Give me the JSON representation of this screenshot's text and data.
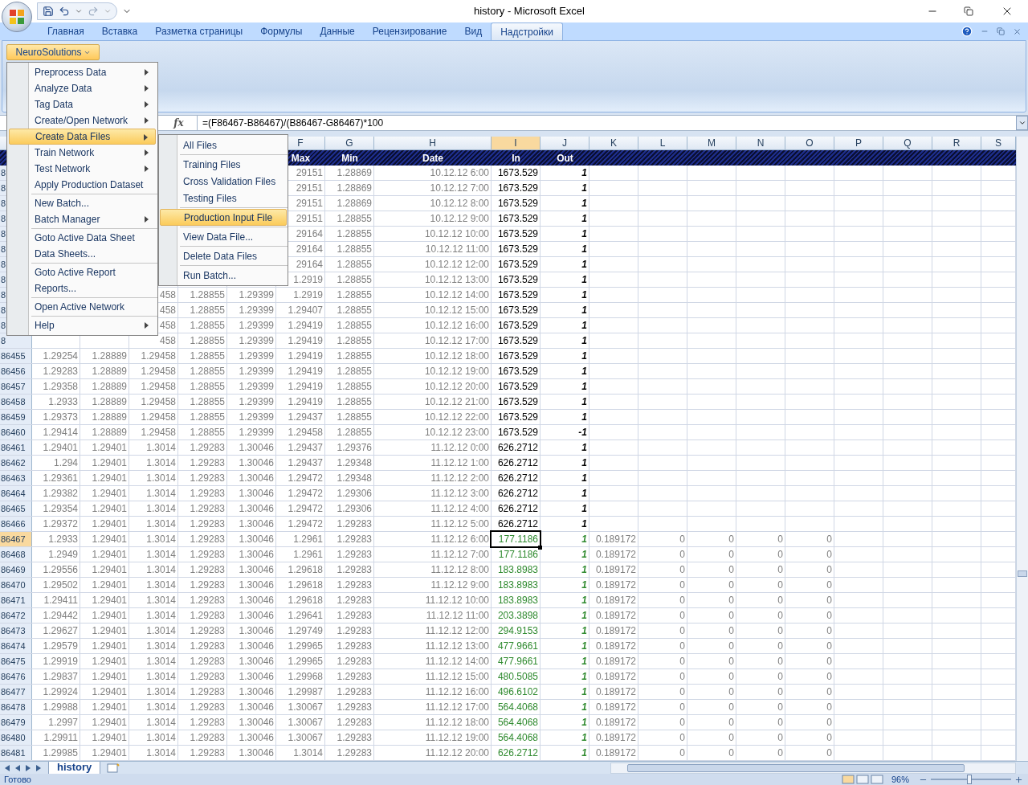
{
  "window": {
    "title": "history - Microsoft Excel"
  },
  "ribbon_tabs": [
    {
      "label": "Главная",
      "selected": false
    },
    {
      "label": "Вставка",
      "selected": false
    },
    {
      "label": "Разметка страницы",
      "selected": false
    },
    {
      "label": "Формулы",
      "selected": false
    },
    {
      "label": "Данные",
      "selected": false
    },
    {
      "label": "Рецензирование",
      "selected": false
    },
    {
      "label": "Вид",
      "selected": false
    },
    {
      "label": "Надстройки",
      "selected": true
    }
  ],
  "addin_button": {
    "label": "NeuroSolutions"
  },
  "formula_bar": {
    "function_label": "fx",
    "formula": "=(F86467-B86467)/(B86467-G86467)*100"
  },
  "main_menu": {
    "groups": [
      [
        {
          "label": "Preprocess Data",
          "submenu": true,
          "selected": false
        },
        {
          "label": "Analyze Data",
          "submenu": true,
          "selected": false
        },
        {
          "label": "Tag Data",
          "submenu": true,
          "selected": false
        },
        {
          "label": "Create/Open Network",
          "submenu": true,
          "selected": false
        },
        {
          "label": "Create Data Files",
          "submenu": true,
          "selected": true
        },
        {
          "label": "Train Network",
          "submenu": true,
          "selected": false
        },
        {
          "label": "Test Network",
          "submenu": true,
          "selected": false
        },
        {
          "label": "Apply Production Dataset",
          "submenu": false,
          "selected": false
        }
      ],
      [
        {
          "label": "New Batch...",
          "submenu": false,
          "selected": false
        },
        {
          "label": "Batch Manager",
          "submenu": true,
          "selected": false
        }
      ],
      [
        {
          "label": "Goto Active Data Sheet",
          "submenu": false,
          "selected": false
        },
        {
          "label": "Data Sheets...",
          "submenu": false,
          "selected": false
        }
      ],
      [
        {
          "label": "Goto Active Report",
          "submenu": false,
          "selected": false
        },
        {
          "label": "Reports...",
          "submenu": false,
          "selected": false
        }
      ],
      [
        {
          "label": "Open Active Network",
          "submenu": false,
          "selected": false
        }
      ],
      [
        {
          "label": "Help",
          "submenu": true,
          "selected": false
        }
      ]
    ]
  },
  "submenu": {
    "groups": [
      [
        {
          "label": "All Files",
          "selected": false
        }
      ],
      [
        {
          "label": "Training Files",
          "selected": false
        },
        {
          "label": "Cross Validation Files",
          "selected": false
        },
        {
          "label": "Testing Files",
          "selected": false
        }
      ],
      [
        {
          "label": "Production Input File",
          "selected": true
        }
      ],
      [
        {
          "label": "View Data File...",
          "selected": false
        }
      ],
      [
        {
          "label": "Delete Data Files",
          "selected": false
        }
      ],
      [
        {
          "label": "Run Batch...",
          "selected": false
        }
      ]
    ]
  },
  "columns": [
    {
      "letter": "F",
      "selected": false
    },
    {
      "letter": "G",
      "selected": false
    },
    {
      "letter": "H",
      "selected": false
    },
    {
      "letter": "I",
      "selected": true
    },
    {
      "letter": "J",
      "selected": false
    },
    {
      "letter": "K",
      "selected": false
    },
    {
      "letter": "L",
      "selected": false
    },
    {
      "letter": "M",
      "selected": false
    },
    {
      "letter": "N",
      "selected": false
    },
    {
      "letter": "O",
      "selected": false
    },
    {
      "letter": "P",
      "selected": false
    },
    {
      "letter": "Q",
      "selected": false
    },
    {
      "letter": "R",
      "selected": false
    },
    {
      "letter": "S",
      "selected": false
    }
  ],
  "title_row": {
    "F": "Max",
    "G": "Min",
    "H": "Date",
    "I": "In",
    "J": "Out"
  },
  "rows": [
    {
      "header": "8",
      "selected": false,
      "conditional_format": false,
      "cells": {
        "F": "29151",
        "G": "1.28869",
        "H": "10.12.12 6:00",
        "I": "1673.529",
        "J": "1"
      }
    },
    {
      "header": "8",
      "selected": false,
      "conditional_format": false,
      "cells": {
        "F": "29151",
        "G": "1.28869",
        "H": "10.12.12 7:00",
        "I": "1673.529",
        "J": "1"
      }
    },
    {
      "header": "8",
      "selected": false,
      "conditional_format": false,
      "cells": {
        "F": "29151",
        "G": "1.28869",
        "H": "10.12.12 8:00",
        "I": "1673.529",
        "J": "1"
      }
    },
    {
      "header": "8",
      "selected": false,
      "conditional_format": false,
      "cells": {
        "F": "29151",
        "G": "1.28855",
        "H": "10.12.12 9:00",
        "I": "1673.529",
        "J": "1"
      }
    },
    {
      "header": "8",
      "selected": false,
      "conditional_format": false,
      "cells": {
        "F": "29164",
        "G": "1.28855",
        "H": "10.12.12 10:00",
        "I": "1673.529",
        "J": "1"
      }
    },
    {
      "header": "8",
      "selected": false,
      "conditional_format": false,
      "cells": {
        "F": "29164",
        "G": "1.28855",
        "H": "10.12.12 11:00",
        "I": "1673.529",
        "J": "1"
      }
    },
    {
      "header": "8",
      "selected": false,
      "conditional_format": false,
      "cells": {
        "F": "29164",
        "G": "1.28855",
        "H": "10.12.12 12:00",
        "I": "1673.529",
        "J": "1"
      }
    },
    {
      "header": "8",
      "selected": false,
      "conditional_format": false,
      "cells": {
        "F": "1.2919",
        "G": "1.28855",
        "H": "10.12.12 13:00",
        "I": "1673.529",
        "J": "1"
      }
    },
    {
      "header": "8",
      "selected": false,
      "conditional_format": false,
      "cells": {
        "C": "458",
        "D": "1.28855",
        "E": "1.29399",
        "F": "1.2919",
        "G": "1.28855",
        "H": "10.12.12 14:00",
        "I": "1673.529",
        "J": "1"
      }
    },
    {
      "header": "8",
      "selected": false,
      "conditional_format": false,
      "cells": {
        "C": "458",
        "D": "1.28855",
        "E": "1.29399",
        "F": "1.29407",
        "G": "1.28855",
        "H": "10.12.12 15:00",
        "I": "1673.529",
        "J": "1"
      }
    },
    {
      "header": "8",
      "selected": false,
      "conditional_format": false,
      "cells": {
        "C": "458",
        "D": "1.28855",
        "E": "1.29399",
        "F": "1.29419",
        "G": "1.28855",
        "H": "10.12.12 16:00",
        "I": "1673.529",
        "J": "1"
      }
    },
    {
      "header": "8",
      "selected": false,
      "conditional_format": false,
      "cells": {
        "C": "458",
        "D": "1.28855",
        "E": "1.29399",
        "F": "1.29419",
        "G": "1.28855",
        "H": "10.12.12 17:00",
        "I": "1673.529",
        "J": "1"
      }
    },
    {
      "header": "86455",
      "selected": false,
      "conditional_format": false,
      "cells": {
        "A": "1.29254",
        "B": "1.28889",
        "C": "1.29458",
        "D": "1.28855",
        "E": "1.29399",
        "F": "1.29419",
        "G": "1.28855",
        "H": "10.12.12 18:00",
        "I": "1673.529",
        "J": "1"
      }
    },
    {
      "header": "86456",
      "selected": false,
      "conditional_format": false,
      "cells": {
        "A": "1.29283",
        "B": "1.28889",
        "C": "1.29458",
        "D": "1.28855",
        "E": "1.29399",
        "F": "1.29419",
        "G": "1.28855",
        "H": "10.12.12 19:00",
        "I": "1673.529",
        "J": "1"
      }
    },
    {
      "header": "86457",
      "selected": false,
      "conditional_format": false,
      "cells": {
        "A": "1.29358",
        "B": "1.28889",
        "C": "1.29458",
        "D": "1.28855",
        "E": "1.29399",
        "F": "1.29419",
        "G": "1.28855",
        "H": "10.12.12 20:00",
        "I": "1673.529",
        "J": "1"
      }
    },
    {
      "header": "86458",
      "selected": false,
      "conditional_format": false,
      "cells": {
        "A": "1.2933",
        "B": "1.28889",
        "C": "1.29458",
        "D": "1.28855",
        "E": "1.29399",
        "F": "1.29419",
        "G": "1.28855",
        "H": "10.12.12 21:00",
        "I": "1673.529",
        "J": "1"
      }
    },
    {
      "header": "86459",
      "selected": false,
      "conditional_format": false,
      "cells": {
        "A": "1.29373",
        "B": "1.28889",
        "C": "1.29458",
        "D": "1.28855",
        "E": "1.29399",
        "F": "1.29437",
        "G": "1.28855",
        "H": "10.12.12 22:00",
        "I": "1673.529",
        "J": "1"
      }
    },
    {
      "header": "86460",
      "selected": false,
      "conditional_format": false,
      "cells": {
        "A": "1.29414",
        "B": "1.28889",
        "C": "1.29458",
        "D": "1.28855",
        "E": "1.29399",
        "F": "1.29458",
        "G": "1.28855",
        "H": "10.12.12 23:00",
        "I": "1673.529",
        "J": "-1"
      }
    },
    {
      "header": "86461",
      "selected": false,
      "conditional_format": false,
      "cells": {
        "A": "1.29401",
        "B": "1.29401",
        "C": "1.3014",
        "D": "1.29283",
        "E": "1.30046",
        "F": "1.29437",
        "G": "1.29376",
        "H": "11.12.12 0:00",
        "I": "626.2712",
        "J": "1"
      }
    },
    {
      "header": "86462",
      "selected": false,
      "conditional_format": false,
      "cells": {
        "A": "1.294",
        "B": "1.29401",
        "C": "1.3014",
        "D": "1.29283",
        "E": "1.30046",
        "F": "1.29437",
        "G": "1.29348",
        "H": "11.12.12 1:00",
        "I": "626.2712",
        "J": "1"
      }
    },
    {
      "header": "86463",
      "selected": false,
      "conditional_format": false,
      "cells": {
        "A": "1.29361",
        "B": "1.29401",
        "C": "1.3014",
        "D": "1.29283",
        "E": "1.30046",
        "F": "1.29472",
        "G": "1.29348",
        "H": "11.12.12 2:00",
        "I": "626.2712",
        "J": "1"
      }
    },
    {
      "header": "86464",
      "selected": false,
      "conditional_format": false,
      "cells": {
        "A": "1.29382",
        "B": "1.29401",
        "C": "1.3014",
        "D": "1.29283",
        "E": "1.30046",
        "F": "1.29472",
        "G": "1.29306",
        "H": "11.12.12 3:00",
        "I": "626.2712",
        "J": "1"
      }
    },
    {
      "header": "86465",
      "selected": false,
      "conditional_format": false,
      "cells": {
        "A": "1.29354",
        "B": "1.29401",
        "C": "1.3014",
        "D": "1.29283",
        "E": "1.30046",
        "F": "1.29472",
        "G": "1.29306",
        "H": "11.12.12 4:00",
        "I": "626.2712",
        "J": "1"
      }
    },
    {
      "header": "86466",
      "selected": false,
      "conditional_format": false,
      "cells": {
        "A": "1.29372",
        "B": "1.29401",
        "C": "1.3014",
        "D": "1.29283",
        "E": "1.30046",
        "F": "1.29472",
        "G": "1.29283",
        "H": "11.12.12 5:00",
        "I": "626.2712",
        "J": "1"
      }
    },
    {
      "header": "86467",
      "selected": true,
      "conditional_format": true,
      "cells": {
        "A": "1.2933",
        "B": "1.29401",
        "C": "1.3014",
        "D": "1.29283",
        "E": "1.30046",
        "F": "1.2961",
        "G": "1.29283",
        "H": "11.12.12 6:00",
        "I": "177.1186",
        "J": "1",
        "K": "0.189172",
        "L": "0",
        "M": "0",
        "N": "0",
        "O": "0"
      }
    },
    {
      "header": "86468",
      "selected": false,
      "conditional_format": true,
      "cells": {
        "A": "1.2949",
        "B": "1.29401",
        "C": "1.3014",
        "D": "1.29283",
        "E": "1.30046",
        "F": "1.2961",
        "G": "1.29283",
        "H": "11.12.12 7:00",
        "I": "177.1186",
        "J": "1",
        "K": "0.189172",
        "L": "0",
        "M": "0",
        "N": "0",
        "O": "0"
      }
    },
    {
      "header": "86469",
      "selected": false,
      "conditional_format": true,
      "cells": {
        "A": "1.29556",
        "B": "1.29401",
        "C": "1.3014",
        "D": "1.29283",
        "E": "1.30046",
        "F": "1.29618",
        "G": "1.29283",
        "H": "11.12.12 8:00",
        "I": "183.8983",
        "J": "1",
        "K": "0.189172",
        "L": "0",
        "M": "0",
        "N": "0",
        "O": "0"
      }
    },
    {
      "header": "86470",
      "selected": false,
      "conditional_format": true,
      "cells": {
        "A": "1.29502",
        "B": "1.29401",
        "C": "1.3014",
        "D": "1.29283",
        "E": "1.30046",
        "F": "1.29618",
        "G": "1.29283",
        "H": "11.12.12 9:00",
        "I": "183.8983",
        "J": "1",
        "K": "0.189172",
        "L": "0",
        "M": "0",
        "N": "0",
        "O": "0"
      }
    },
    {
      "header": "86471",
      "selected": false,
      "conditional_format": true,
      "cells": {
        "A": "1.29411",
        "B": "1.29401",
        "C": "1.3014",
        "D": "1.29283",
        "E": "1.30046",
        "F": "1.29618",
        "G": "1.29283",
        "H": "11.12.12 10:00",
        "I": "183.8983",
        "J": "1",
        "K": "0.189172",
        "L": "0",
        "M": "0",
        "N": "0",
        "O": "0"
      }
    },
    {
      "header": "86472",
      "selected": false,
      "conditional_format": true,
      "cells": {
        "A": "1.29442",
        "B": "1.29401",
        "C": "1.3014",
        "D": "1.29283",
        "E": "1.30046",
        "F": "1.29641",
        "G": "1.29283",
        "H": "11.12.12 11:00",
        "I": "203.3898",
        "J": "1",
        "K": "0.189172",
        "L": "0",
        "M": "0",
        "N": "0",
        "O": "0"
      }
    },
    {
      "header": "86473",
      "selected": false,
      "conditional_format": true,
      "cells": {
        "A": "1.29627",
        "B": "1.29401",
        "C": "1.3014",
        "D": "1.29283",
        "E": "1.30046",
        "F": "1.29749",
        "G": "1.29283",
        "H": "11.12.12 12:00",
        "I": "294.9153",
        "J": "1",
        "K": "0.189172",
        "L": "0",
        "M": "0",
        "N": "0",
        "O": "0"
      }
    },
    {
      "header": "86474",
      "selected": false,
      "conditional_format": true,
      "cells": {
        "A": "1.29579",
        "B": "1.29401",
        "C": "1.3014",
        "D": "1.29283",
        "E": "1.30046",
        "F": "1.29965",
        "G": "1.29283",
        "H": "11.12.12 13:00",
        "I": "477.9661",
        "J": "1",
        "K": "0.189172",
        "L": "0",
        "M": "0",
        "N": "0",
        "O": "0"
      }
    },
    {
      "header": "86475",
      "selected": false,
      "conditional_format": true,
      "cells": {
        "A": "1.29919",
        "B": "1.29401",
        "C": "1.3014",
        "D": "1.29283",
        "E": "1.30046",
        "F": "1.29965",
        "G": "1.29283",
        "H": "11.12.12 14:00",
        "I": "477.9661",
        "J": "1",
        "K": "0.189172",
        "L": "0",
        "M": "0",
        "N": "0",
        "O": "0"
      }
    },
    {
      "header": "86476",
      "selected": false,
      "conditional_format": true,
      "cells": {
        "A": "1.29837",
        "B": "1.29401",
        "C": "1.3014",
        "D": "1.29283",
        "E": "1.30046",
        "F": "1.29968",
        "G": "1.29283",
        "H": "11.12.12 15:00",
        "I": "480.5085",
        "J": "1",
        "K": "0.189172",
        "L": "0",
        "M": "0",
        "N": "0",
        "O": "0"
      }
    },
    {
      "header": "86477",
      "selected": false,
      "conditional_format": true,
      "cells": {
        "A": "1.29924",
        "B": "1.29401",
        "C": "1.3014",
        "D": "1.29283",
        "E": "1.30046",
        "F": "1.29987",
        "G": "1.29283",
        "H": "11.12.12 16:00",
        "I": "496.6102",
        "J": "1",
        "K": "0.189172",
        "L": "0",
        "M": "0",
        "N": "0",
        "O": "0"
      }
    },
    {
      "header": "86478",
      "selected": false,
      "conditional_format": true,
      "cells": {
        "A": "1.29988",
        "B": "1.29401",
        "C": "1.3014",
        "D": "1.29283",
        "E": "1.30046",
        "F": "1.30067",
        "G": "1.29283",
        "H": "11.12.12 17:00",
        "I": "564.4068",
        "J": "1",
        "K": "0.189172",
        "L": "0",
        "M": "0",
        "N": "0",
        "O": "0"
      }
    },
    {
      "header": "86479",
      "selected": false,
      "conditional_format": true,
      "cells": {
        "A": "1.2997",
        "B": "1.29401",
        "C": "1.3014",
        "D": "1.29283",
        "E": "1.30046",
        "F": "1.30067",
        "G": "1.29283",
        "H": "11.12.12 18:00",
        "I": "564.4068",
        "J": "1",
        "K": "0.189172",
        "L": "0",
        "M": "0",
        "N": "0",
        "O": "0"
      }
    },
    {
      "header": "86480",
      "selected": false,
      "conditional_format": true,
      "cells": {
        "A": "1.29911",
        "B": "1.29401",
        "C": "1.3014",
        "D": "1.29283",
        "E": "1.30046",
        "F": "1.30067",
        "G": "1.29283",
        "H": "11.12.12 19:00",
        "I": "564.4068",
        "J": "1",
        "K": "0.189172",
        "L": "0",
        "M": "0",
        "N": "0",
        "O": "0"
      }
    },
    {
      "header": "86481",
      "selected": false,
      "conditional_format": true,
      "cells": {
        "A": "1.29985",
        "B": "1.29401",
        "C": "1.3014",
        "D": "1.29283",
        "E": "1.30046",
        "F": "1.3014",
        "G": "1.29283",
        "H": "11.12.12 20:00",
        "I": "626.2712",
        "J": "1",
        "K": "0.189172",
        "L": "0",
        "M": "0",
        "N": "0",
        "O": "0"
      }
    }
  ],
  "sheet_tabs": [
    {
      "label": "history",
      "selected": true
    }
  ],
  "status_bar": {
    "status": "Готово",
    "zoom": "96%",
    "zoom_slider": {
      "level": 0.48
    }
  }
}
